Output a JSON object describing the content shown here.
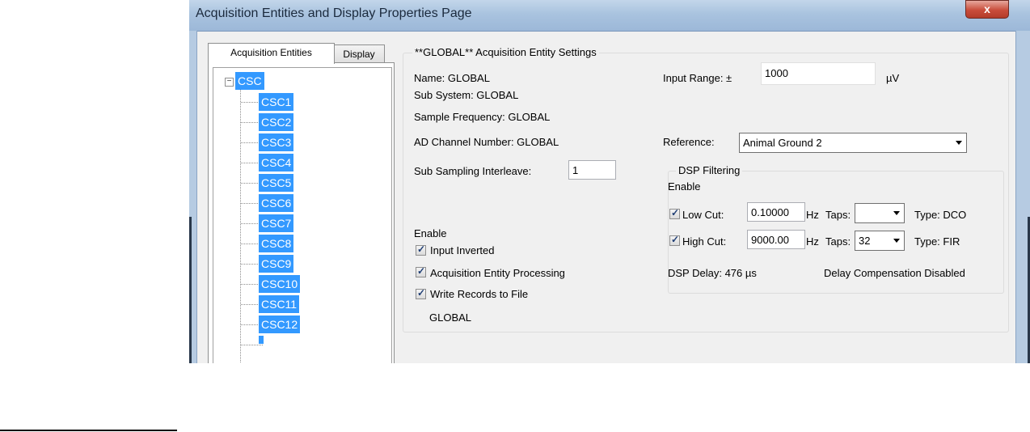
{
  "window": {
    "title": "Acquisition Entities and Display Properties Page",
    "close_label": "x"
  },
  "tabs": [
    "Acquisition Entities",
    "Display"
  ],
  "tree": {
    "expander": "−",
    "root": "CSC",
    "children": [
      "CSC1",
      "CSC2",
      "CSC3",
      "CSC4",
      "CSC5",
      "CSC6",
      "CSC7",
      "CSC8",
      "CSC9",
      "CSC10",
      "CSC11",
      "CSC12"
    ]
  },
  "settings": {
    "group_title": "**GLOBAL** Acquisition Entity Settings",
    "name": "Name:  GLOBAL",
    "sub_system": "Sub System:  GLOBAL",
    "sample_frequency": "Sample Frequency:  GLOBAL",
    "ad_channel": "AD Channel Number:  GLOBAL",
    "sub_sampling_label": "Sub Sampling Interleave:",
    "sub_sampling_value": "1",
    "enable_label": "Enable",
    "input_inverted": "Input Inverted",
    "acq_processing": "Acquisition Entity Processing",
    "write_records": "Write Records to File",
    "footer_value": "GLOBAL",
    "input_range_label": "Input Range:  ±",
    "input_range_value": "1000",
    "input_range_unit": "µV",
    "reference_label": "Reference:",
    "reference_value": "Animal Ground 2"
  },
  "dsp": {
    "group_title": "DSP Filtering",
    "enable_label": "Enable",
    "low_cut_label": "Low Cut:",
    "low_cut_value": "0.10000",
    "high_cut_label": "High Cut:",
    "high_cut_value": "9000.00",
    "hz": "Hz",
    "taps_label": "Taps:",
    "low_taps_value": "",
    "high_taps_value": "32",
    "low_type": "Type: DCO",
    "high_type": "Type: FIR",
    "delay": "DSP Delay:  476 µs",
    "compensation": "Delay Compensation Disabled"
  }
}
